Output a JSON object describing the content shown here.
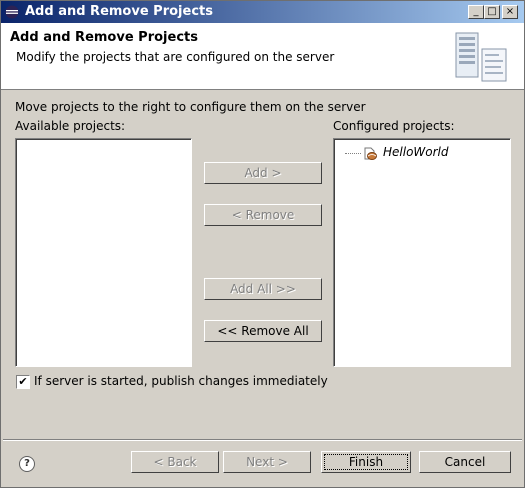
{
  "window": {
    "title": "Add and Remove Projects",
    "controls": {
      "minimize": "_",
      "maximize": "□",
      "close": "×"
    }
  },
  "header": {
    "title": "Add and Remove Projects",
    "description": "Modify the projects that are configured on the server",
    "icon": "server-wizard-icon"
  },
  "body": {
    "instructions": "Move projects to the right to configure them on the server",
    "available_label": "Available projects:",
    "configured_label": "Configured projects:",
    "available_projects": [],
    "configured_projects": [
      {
        "name": "HelloWorld",
        "icon": "web-project-icon"
      }
    ]
  },
  "actions": {
    "add": "Add >",
    "remove": "< Remove",
    "add_all": "Add All >>",
    "remove_all": "<< Remove All"
  },
  "publish_option": {
    "label": "If server is started, publish changes immediately",
    "checked": true,
    "checkmark": "✔"
  },
  "footer": {
    "help_glyph": "?",
    "back": "< Back",
    "next": "Next >",
    "finish": "Finish",
    "cancel": "Cancel"
  }
}
